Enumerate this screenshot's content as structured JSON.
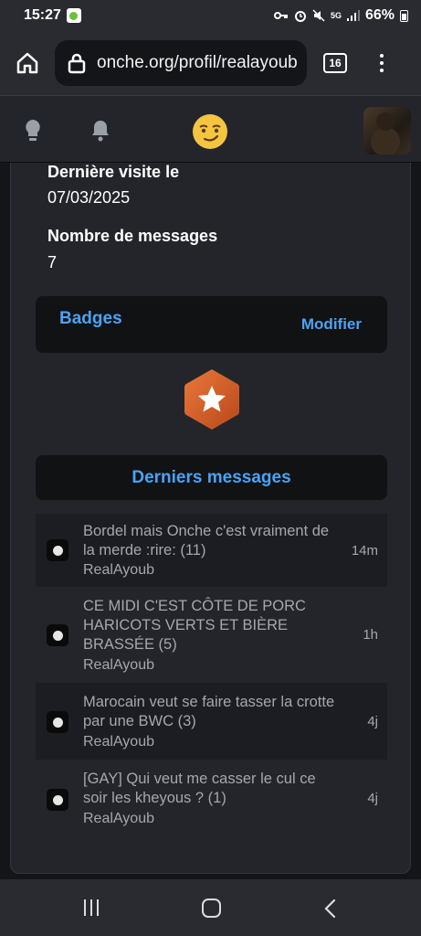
{
  "status_bar": {
    "time": "15:27",
    "network": "5G",
    "battery": "66%"
  },
  "browser": {
    "url": "onche.org/profil/realayoub",
    "tab_count": "16"
  },
  "profile": {
    "last_visit_label": "Dernière visite le",
    "last_visit_value": "07/03/2025",
    "messages_label": "Nombre de messages",
    "messages_value": "7"
  },
  "badges": {
    "title": "Badges",
    "edit_label": "Modifier"
  },
  "latest": {
    "title": "Derniers messages",
    "items": [
      {
        "title": "Bordel mais Onche c'est vraiment de la merde :rire: (11)",
        "author": "RealAyoub",
        "time": "14m"
      },
      {
        "title": "CE MIDI C'EST CÔTE DE PORC HARICOTS VERTS ET BIÈRE BRASSÉE (5)",
        "author": "RealAyoub",
        "time": "1h"
      },
      {
        "title": "Marocain veut se faire tasser la crotte par une BWC (3)",
        "author": "RealAyoub",
        "time": "4j"
      },
      {
        "title": "[GAY] Qui veut me casser le cul ce soir les kheyous ? (1)",
        "author": "RealAyoub",
        "time": "4j"
      }
    ]
  },
  "colors": {
    "accent": "#4aa3f5",
    "badge": "#d9642c",
    "logo": "#f5c542"
  },
  "icons": [
    "home-icon",
    "lock-icon",
    "bulb-icon",
    "bell-icon",
    "smirk-logo-icon",
    "star-badge-icon"
  ]
}
